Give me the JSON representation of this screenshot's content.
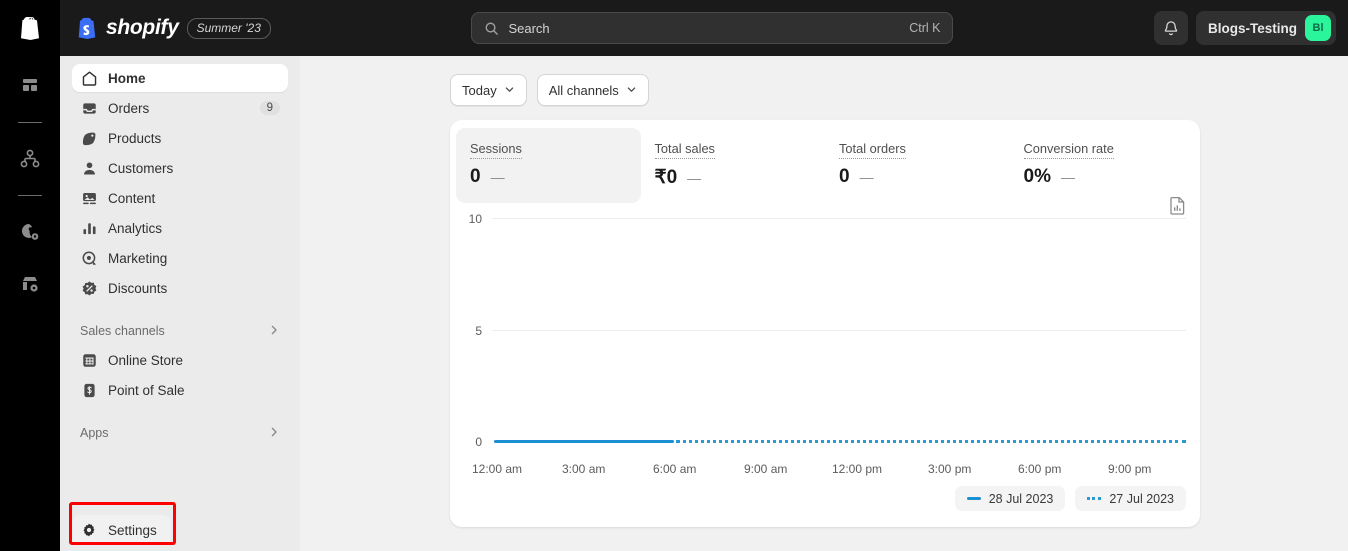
{
  "rail": {
    "logo_icon": "shopify-bag-icon",
    "items": [
      {
        "icon": "dashboard-grid-icon",
        "name": "rail-item-dashboard"
      },
      {
        "icon": "node-graph-icon",
        "name": "rail-item-flows"
      },
      {
        "icon": "user-settings-icon",
        "name": "rail-item-account-settings"
      },
      {
        "icon": "store-settings-icon",
        "name": "rail-item-store-settings"
      }
    ]
  },
  "topbar": {
    "brand_name": "shopify",
    "brand_badge": "Summer '23",
    "search": {
      "placeholder": "Search",
      "value": "Search",
      "shortcut": "Ctrl K",
      "icon": "search-icon"
    },
    "notifications_icon": "bell-icon",
    "store_name": "Blogs-Testing",
    "avatar_initials": "Bl",
    "avatar_color": "#2bf59b",
    "background": "#1a1a1a"
  },
  "sidebar": {
    "items": [
      {
        "label": "Home",
        "icon": "home-icon",
        "active": true,
        "badge": ""
      },
      {
        "label": "Orders",
        "icon": "orders-inbox-icon",
        "active": false,
        "badge": "9"
      },
      {
        "label": "Products",
        "icon": "product-tag-icon",
        "active": false,
        "badge": ""
      },
      {
        "label": "Customers",
        "icon": "customer-person-icon",
        "active": false,
        "badge": ""
      },
      {
        "label": "Content",
        "icon": "content-image-icon",
        "active": false,
        "badge": ""
      },
      {
        "label": "Analytics",
        "icon": "analytics-bars-icon",
        "active": false,
        "badge": ""
      },
      {
        "label": "Marketing",
        "icon": "marketing-target-icon",
        "active": false,
        "badge": ""
      },
      {
        "label": "Discounts",
        "icon": "discount-badge-icon",
        "active": false,
        "badge": ""
      }
    ],
    "sales_channels": {
      "label": "Sales channels",
      "chevron_icon": "chevron-right-icon",
      "items": [
        {
          "label": "Online Store",
          "icon": "online-store-icon"
        },
        {
          "label": "Point of Sale",
          "icon": "point-of-sale-icon"
        }
      ]
    },
    "apps": {
      "label": "Apps",
      "chevron_icon": "chevron-right-icon"
    },
    "settings": {
      "label": "Settings",
      "icon": "gear-icon",
      "highlight_color": "#ff0000"
    }
  },
  "main": {
    "filters": [
      {
        "label": "Today",
        "icon": "chevron-down-icon",
        "name": "date-range-filter"
      },
      {
        "label": "All channels",
        "icon": "chevron-down-icon",
        "name": "channel-filter"
      }
    ],
    "report_icon": "report-document-icon",
    "metrics": [
      {
        "label": "Sessions",
        "value": "0",
        "delta": "—",
        "selected": true
      },
      {
        "label": "Total sales",
        "value": "₹0",
        "delta": "—",
        "selected": false
      },
      {
        "label": "Total orders",
        "value": "0",
        "delta": "—",
        "selected": false
      },
      {
        "label": "Conversion rate",
        "value": "0%",
        "delta": "—",
        "selected": false
      }
    ]
  },
  "chart_data": {
    "type": "line",
    "title": "Sessions",
    "xlabel": "",
    "ylabel": "",
    "ylim": [
      0,
      10
    ],
    "y_ticks": [
      "0",
      "5",
      "10"
    ],
    "x_ticks": [
      "12:00 am",
      "3:00 am",
      "6:00 am",
      "9:00 am",
      "12:00 pm",
      "3:00 pm",
      "6:00 pm",
      "9:00 pm"
    ],
    "grid": true,
    "legend_position": "bottom-right",
    "series": [
      {
        "name": "28 Jul 2023",
        "style": "solid",
        "color": "#1a8fd1",
        "x": [
          "12:00 am",
          "3:00 am",
          "6:00 am"
        ],
        "values": [
          0,
          0,
          0
        ]
      },
      {
        "name": "27 Jul 2023",
        "style": "dotted",
        "color": "#2a9ad6",
        "x": [
          "6:00 am",
          "9:00 am",
          "12:00 pm",
          "3:00 pm",
          "6:00 pm",
          "9:00 pm",
          "11:59 pm"
        ],
        "values": [
          0,
          0,
          0,
          0,
          0,
          0,
          0
        ]
      }
    ]
  }
}
